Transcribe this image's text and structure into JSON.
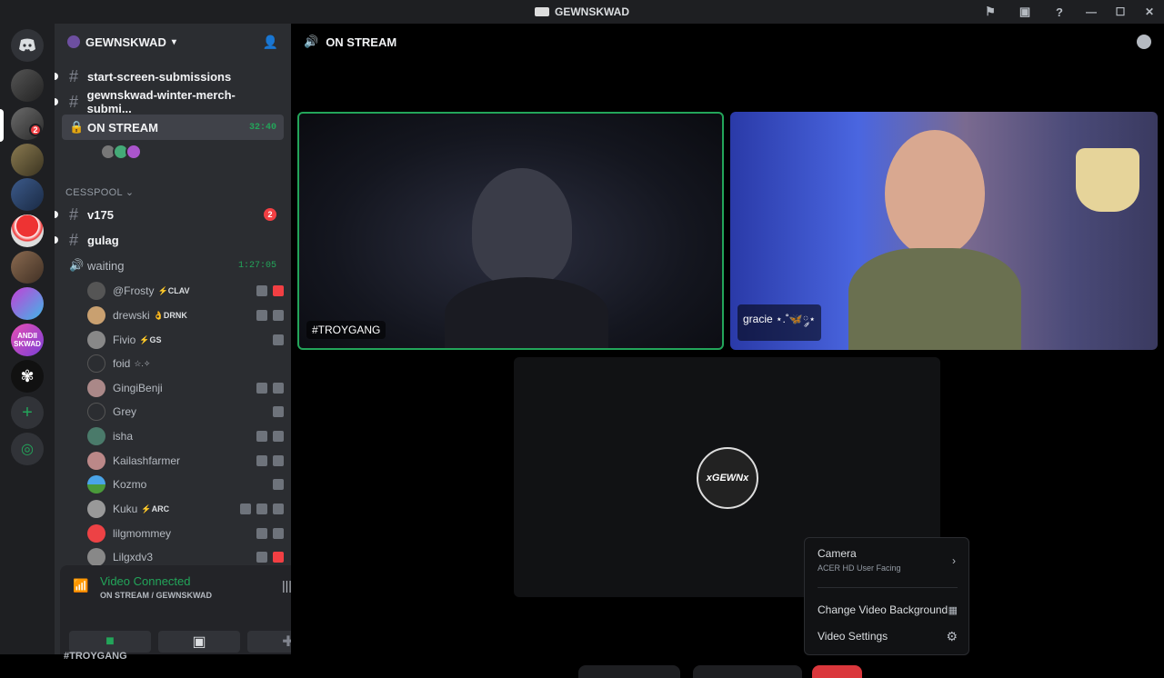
{
  "titlebar": {
    "title": "GEWNSKWAD"
  },
  "server": {
    "name": "GEWNSKWAD"
  },
  "channels": {
    "c1": "start-screen-submissions",
    "c2": "gewnskwad-winter-merch-submi...",
    "active": "ON STREAM",
    "active_timer": "32:40",
    "category": "CESSPOOL",
    "v175": "v175",
    "v175_badge": "2",
    "gulag": "gulag",
    "waiting": "waiting",
    "waiting_timer": "1:27:05"
  },
  "voice_users": [
    {
      "name": "@Frosty",
      "tag": "⚡CLAV"
    },
    {
      "name": "drewski",
      "tag": "👌DRNK"
    },
    {
      "name": "Fivio",
      "tag": "⚡GS"
    },
    {
      "name": "foid",
      "tag": "☆.✧"
    },
    {
      "name": "GingiBenji",
      "tag": ""
    },
    {
      "name": "Grey",
      "tag": ""
    },
    {
      "name": "isha",
      "tag": ""
    },
    {
      "name": "Kailashfarmer",
      "tag": ""
    },
    {
      "name": "Kozmo",
      "tag": ""
    },
    {
      "name": "Kuku",
      "tag": "⚡ARC"
    },
    {
      "name": "lilgmommey",
      "tag": ""
    },
    {
      "name": "Lilgxdv3",
      "tag": ""
    }
  ],
  "guild_badges": {
    "g2": "2"
  },
  "voice_panel": {
    "status": "Video Connected",
    "sub": "ON STREAM / GEWNSKWAD"
  },
  "stream": {
    "header": "ON STREAM",
    "tile1_label": "#TROYGANG",
    "tile2_label": "gracie ⋆.˚🦋༘⋆",
    "avatar_text": "xGEWNx"
  },
  "menu": {
    "camera": "Camera",
    "camera_sub": "ACER HD User Facing",
    "bg": "Change Video Background",
    "settings": "Video Settings"
  },
  "bottom": {
    "partial": "#TROYGANG"
  },
  "colors": {
    "accent_green": "#23a55a",
    "danger": "#f23f43",
    "sidebar": "#2b2d31"
  }
}
